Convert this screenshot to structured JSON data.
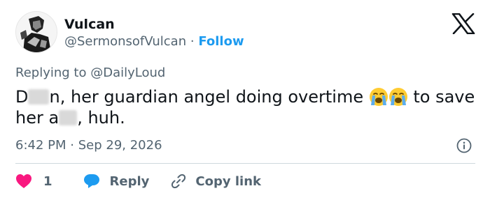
{
  "author": {
    "name": "Vulcan",
    "handle": "@SermonsofVulcan",
    "separator": "·",
    "follow_label": "Follow"
  },
  "reply_context": {
    "prefix": "Replying to",
    "mention": "@DailyLoud"
  },
  "tweet": {
    "text_part1": "D",
    "text_part2": "n, her guardian angel doing overtime",
    "text_part3": "to save her a",
    "text_part4": ", huh.",
    "emojis": [
      "loudly-crying-face",
      "loudly-crying-face"
    ]
  },
  "meta": {
    "time": "6:42 PM",
    "separator": "·",
    "date": "Sep 29, 2026"
  },
  "actions": {
    "like_count": "1",
    "reply_label": "Reply",
    "copy_link_label": "Copy link"
  },
  "colors": {
    "like": "#f91880",
    "reply": "#1d9bf0",
    "link": "#1d9bf0",
    "secondary_text": "#536471",
    "divider": "#cfd9de"
  }
}
